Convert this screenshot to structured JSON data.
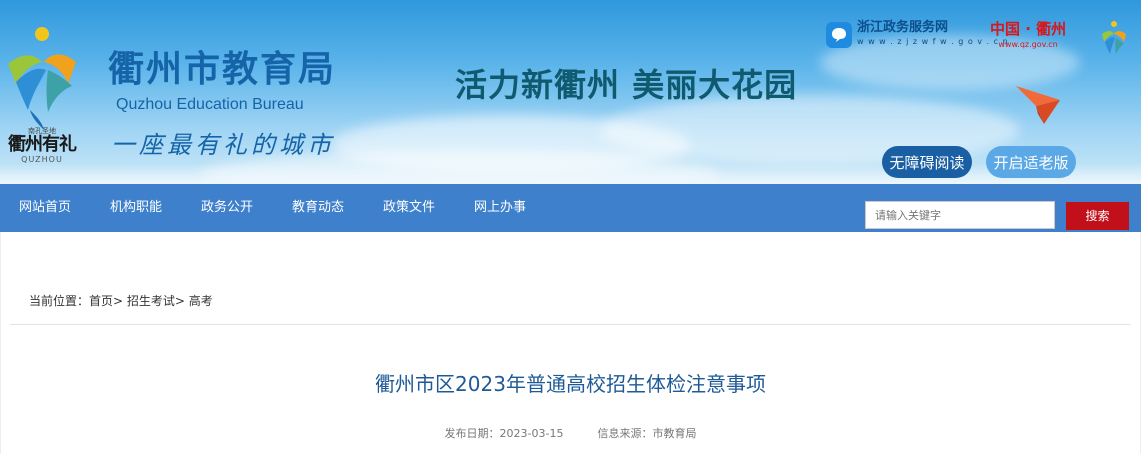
{
  "header": {
    "logo": {
      "sub_text": "南孔圣地",
      "main_text": "衢州有礼",
      "en_text": "QUZHOU"
    },
    "bureau_name_cn": "衢州市教育局",
    "bureau_name_en": "Quzhou Education Bureau",
    "slogan": "一座最有礼的城市",
    "tagline": "活力新衢州  美丽大花园",
    "portals": {
      "zjzw": {
        "name": "浙江政务服务网",
        "url": "w w w . z j z w f w . g o v . c n",
        "icon": "zjzw-portal-icon"
      },
      "quzhou": {
        "name": "中国 · 衢州",
        "url": "www.qz.gov.cn"
      }
    },
    "accessibility_label": "无障碍阅读",
    "elder_mode_label": "开启适老版"
  },
  "nav": {
    "items": [
      {
        "label": "网站首页"
      },
      {
        "label": "机构职能"
      },
      {
        "label": "政务公开"
      },
      {
        "label": "教育动态"
      },
      {
        "label": "政策文件"
      },
      {
        "label": "网上办事"
      }
    ],
    "search": {
      "placeholder": "请输入关键字",
      "button_label": "搜索"
    }
  },
  "content": {
    "breadcrumb": "当前位置：首页> 招生考试> 高考",
    "article": {
      "title": "衢州市区2023年普通高校招生体检注意事项",
      "publish_date": "发布日期：2023-03-15",
      "source": "信息来源：市教育局"
    }
  },
  "colors": {
    "nav_bg": "#3e80cc",
    "search_button": "#c1101a",
    "title_blue": "#1f5a96",
    "bureau_blue": "#1664a8",
    "accessibility_button": "#1a5fa3",
    "elder_button": "#5aa8e5"
  }
}
